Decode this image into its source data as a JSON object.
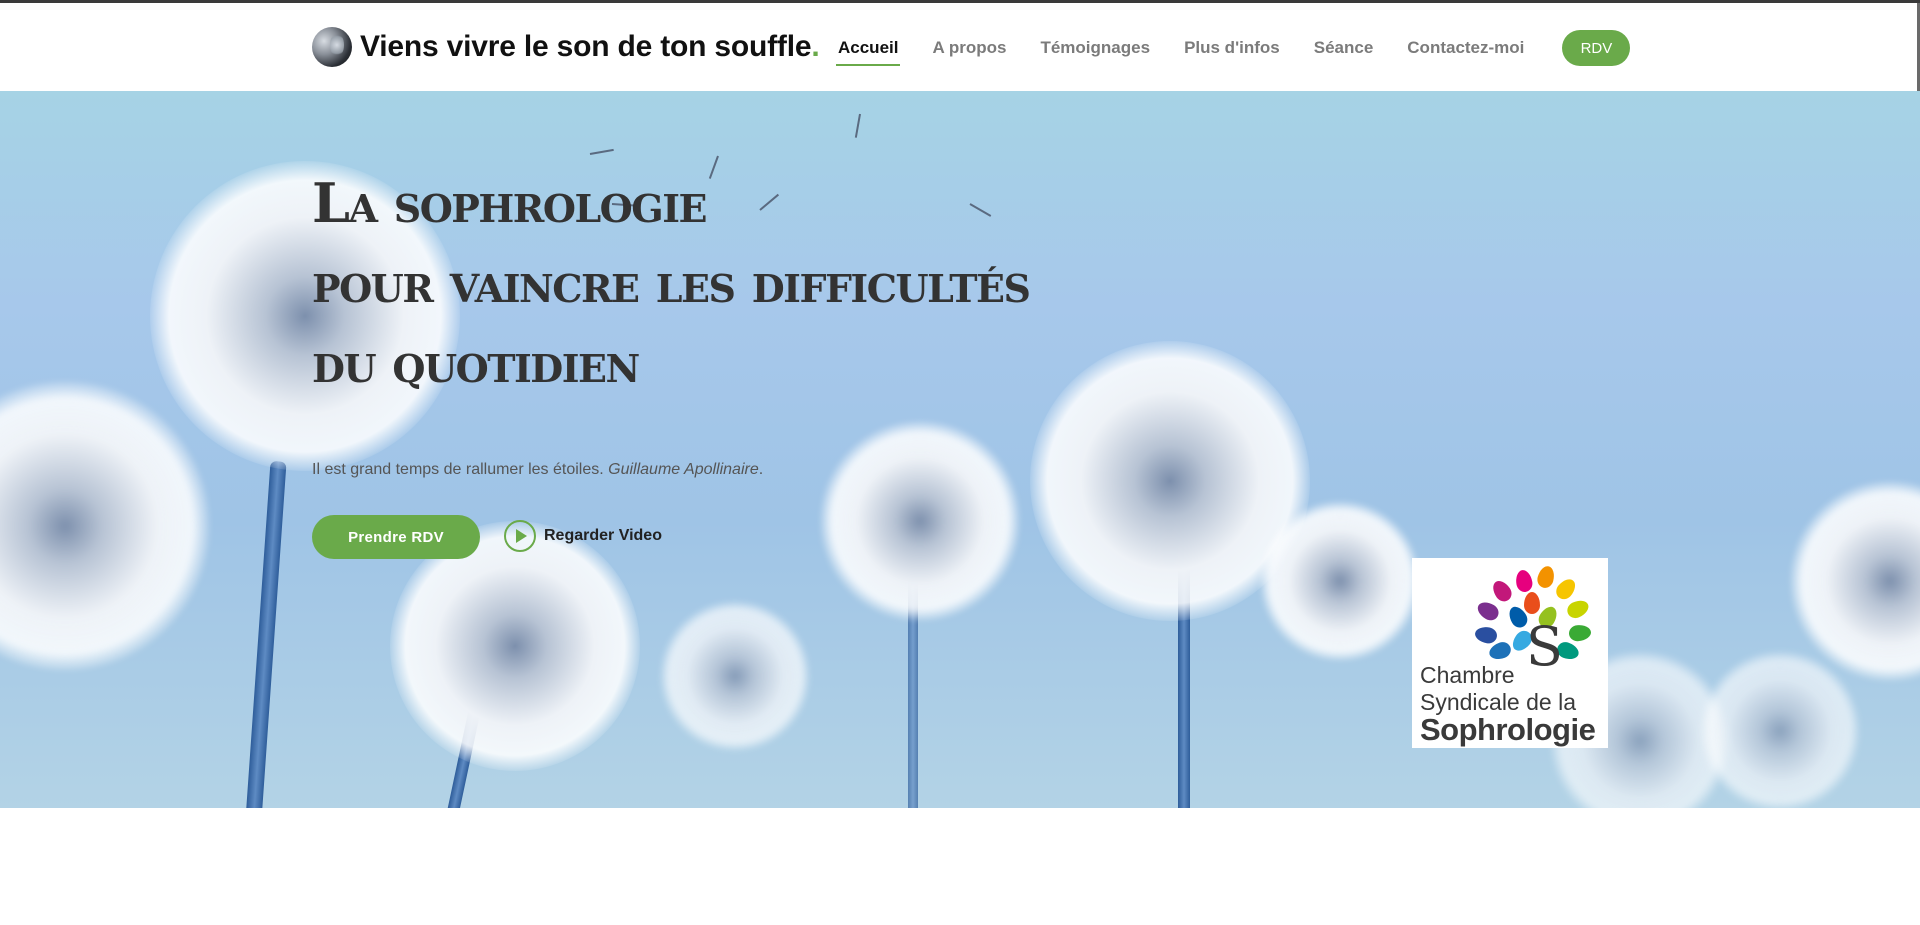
{
  "brand": {
    "title": "Viens vivre le son de ton souffle",
    "dot": "."
  },
  "nav": {
    "items": [
      {
        "label": "Accueil"
      },
      {
        "label": "A propos"
      },
      {
        "label": "Témoignages"
      },
      {
        "label": "Plus d'infos"
      },
      {
        "label": "Séance"
      },
      {
        "label": "Contactez-moi"
      }
    ],
    "cta": "RDV"
  },
  "hero": {
    "headline": [
      "La sophrologie",
      "pour vaincre les difficultés",
      "du quotidien"
    ],
    "quote": "Il est grand temps de rallumer les étoiles.",
    "quote_author": "Guillaume Apollinaire",
    "quote_end": ".",
    "primary_button": "Prendre RDV",
    "video_link": "Regarder Video"
  },
  "badge": {
    "line1": "Chambre",
    "line2": "Syndicale de la",
    "line3": "Sophrologie"
  },
  "colors": {
    "accent": "#6aaa4a",
    "headline": "#333333",
    "nav_inactive": "#7b7b7b"
  }
}
